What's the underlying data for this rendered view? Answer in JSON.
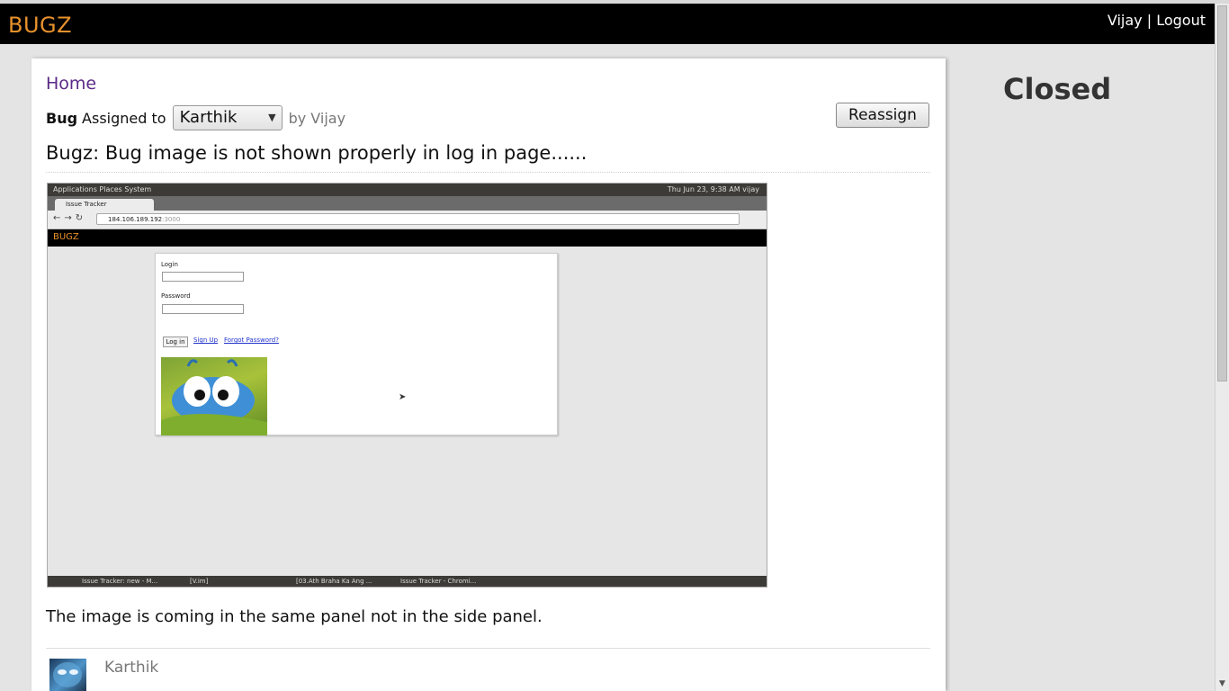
{
  "navbar": {
    "brand": "BUGZ",
    "user": "Vijay",
    "separator": "|",
    "logout": "Logout"
  },
  "breadcrumb": {
    "home": "Home"
  },
  "bug": {
    "label": "Bug",
    "assigned_text": "Assigned to",
    "assignee_selected": "Karthik",
    "byline": "by Vijay",
    "reassign_label": "Reassign",
    "title": "Bugz: Bug image is not shown properly in log in page......",
    "description": "The image is coming in the same panel not in the side panel."
  },
  "attachment": {
    "panel_left": "Applications  Places  System",
    "panel_right": "Thu Jun 23,  9:38 AM   vijay",
    "tab_title": "Issue Tracker",
    "url_host": "184.106.189.192",
    "url_port": ":3000",
    "site_brand": "BUGZ",
    "login_label": "Login",
    "password_label": "Password",
    "login_button": "Log in",
    "signup_link": "Sign Up",
    "forgot_link": "Forgot Password?",
    "taskbar_items": [
      "Issue Tracker: new - M...",
      "[V.im]",
      "[03.Ath Braha Ka Ang ...",
      "Issue Tracker - Chromi..."
    ]
  },
  "comment": {
    "author": "Karthik"
  },
  "status": {
    "label": "Closed"
  },
  "colors": {
    "brand": "#e8922c",
    "navbar_bg": "#000000",
    "page_bg": "#e4e4e4",
    "link": "#5b2a86"
  }
}
